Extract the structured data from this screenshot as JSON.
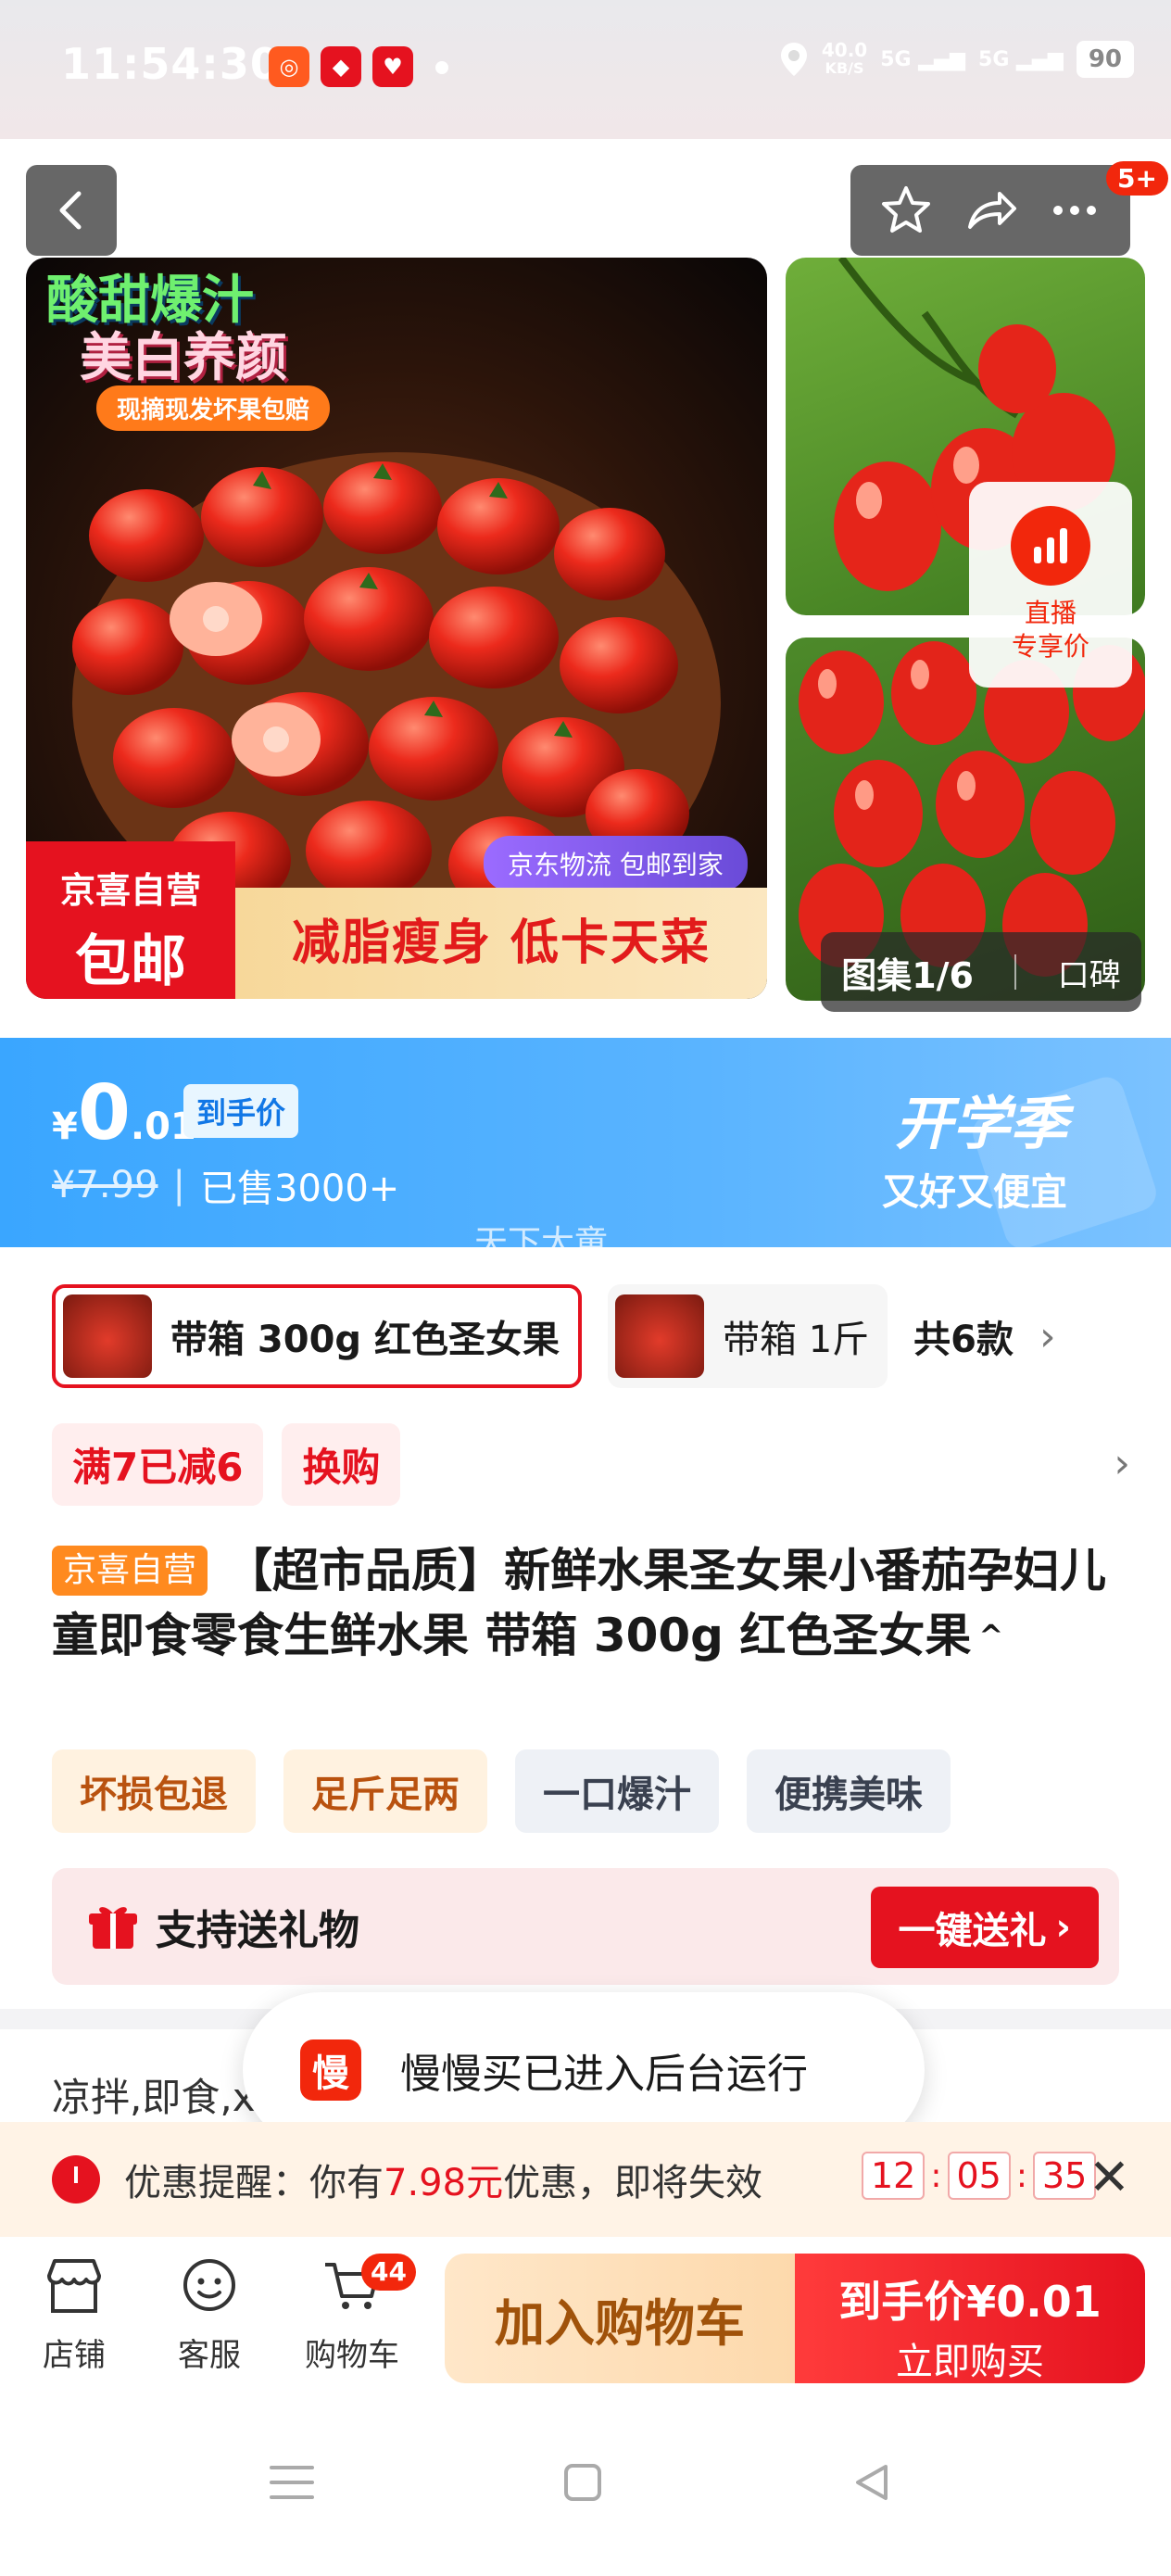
{
  "status_bar": {
    "time": "11:54:30",
    "net_speed_value": "40.0",
    "net_speed_unit": "KB/S",
    "sig1": "5G",
    "sig2": "5G",
    "battery": "90"
  },
  "top_nav": {
    "notif_badge": "5+"
  },
  "gallery": {
    "main_promo_line1": "酸甜爆汁",
    "main_promo_line2": "美白养颜",
    "main_promo_pill": "现摘现发坏果包赔",
    "logistics_tag": "京东物流 包邮到家",
    "ship_badge_line1": "京喜自营",
    "ship_badge_line2": "包邮",
    "slogan": "减脂瘦身  低卡天菜",
    "live_label_line1": "直播",
    "live_label_line2": "专享价",
    "counter": "图集1/6",
    "review_label": "口碑"
  },
  "price": {
    "yen": "¥",
    "integer": "0",
    "decimal": ".01",
    "tag": "到手价",
    "original": "¥7.99",
    "separator": "|",
    "sold": "已售3000+",
    "campaign_title": "开学季",
    "campaign_sub": "又好又便宜",
    "watermark": "天下大童"
  },
  "sku": {
    "options": [
      {
        "label": "带箱 300g 红色圣女果",
        "selected": true
      },
      {
        "label": "带箱 1斤",
        "selected": false
      }
    ],
    "total": "共6款"
  },
  "promotions": {
    "tags": [
      "满7已减6",
      "换购"
    ]
  },
  "product": {
    "self_operated_tag": "京喜自营",
    "title": "【超市品质】新鲜水果圣女果小番茄孕妇儿童即食零食生鲜水果 带箱 300g 红色圣女果",
    "caret": "^"
  },
  "features": [
    {
      "label": "坏损包退",
      "style": "warm"
    },
    {
      "label": "足斤足两",
      "style": "warm"
    },
    {
      "label": "一口爆汁",
      "style": "cool"
    },
    {
      "label": "便携美味",
      "style": "cool"
    }
  ],
  "gift": {
    "label": "支持送礼物",
    "button": "一键送礼"
  },
  "description_peek": "凉拌,即食,x",
  "toast": {
    "icon_char": "慢",
    "text": "慢慢买已进入后台运行"
  },
  "reminder": {
    "prefix": "优惠提醒：你有",
    "amount": "7.98元",
    "suffix": "优惠，即将失效",
    "hours": "12",
    "minutes": "05",
    "seconds": "35",
    "colon": ":"
  },
  "bottom_bar": {
    "shop": "店铺",
    "service": "客服",
    "cart": "购物车",
    "cart_badge": "44",
    "add_to_cart": "加入购物车",
    "buy_price": "到手价¥0.01",
    "buy_label": "立即购买"
  },
  "colors": {
    "brand_red": "#e5121f",
    "price_banner_blue": "#3aa6ff",
    "self_tag_orange": "#ff8a1f"
  }
}
